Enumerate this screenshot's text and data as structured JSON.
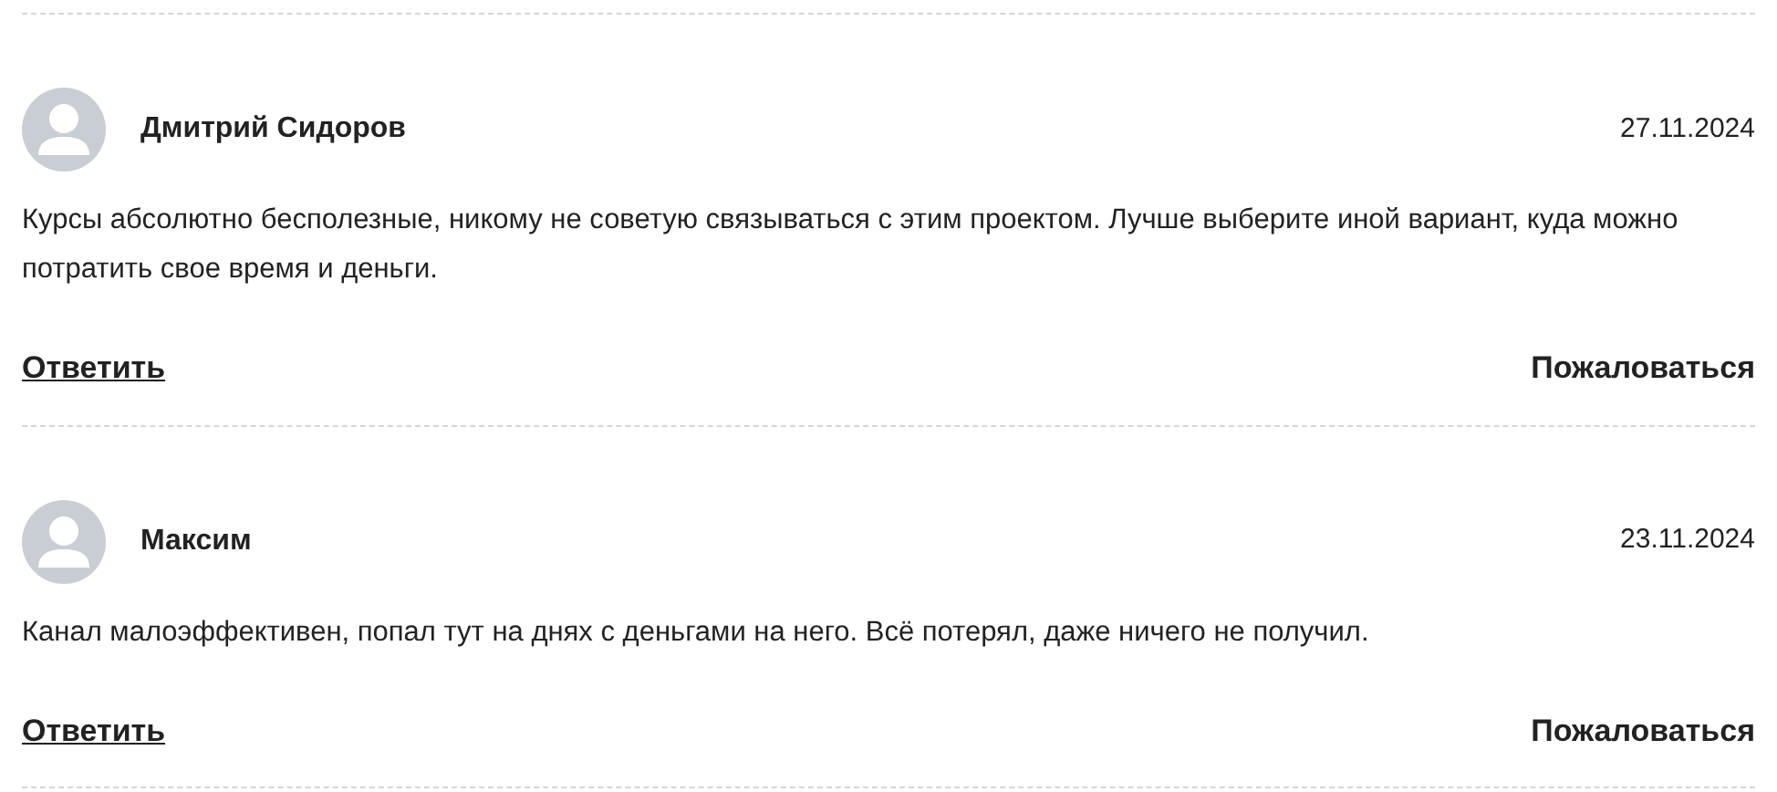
{
  "comments": [
    {
      "author": "Дмитрий Сидоров",
      "date": "27.11.2024",
      "text": "Курсы абсолютно бесполезные, никому не советую связываться с этим проектом. Лучше выберите иной вариант, куда можно потратить свое время и деньги.",
      "reply": "Ответить",
      "report": "Пожаловаться"
    },
    {
      "author": "Максим",
      "date": "23.11.2024",
      "text": "Канал малоэффективен, попал тут на днях с деньгами на него. Всё потерял, даже ничего не получил.",
      "reply": "Ответить",
      "report": "Пожаловаться"
    }
  ]
}
